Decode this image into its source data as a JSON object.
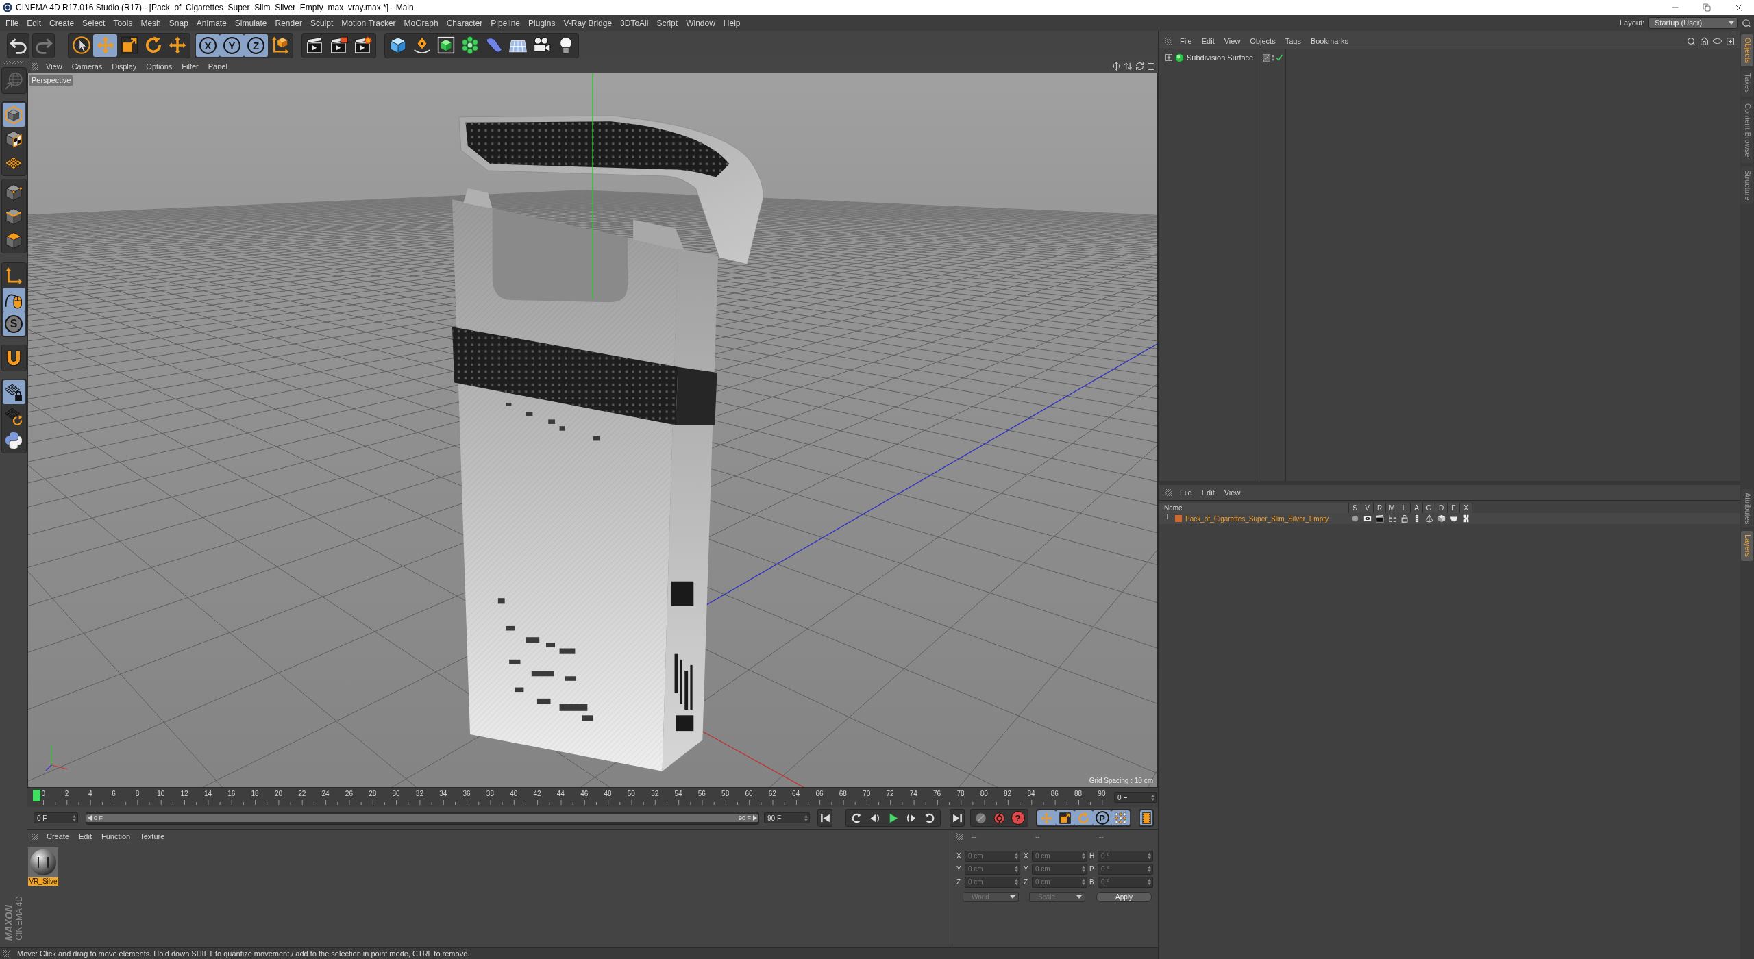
{
  "window": {
    "title": "CINEMA 4D R17.016 Studio (R17) - [Pack_of_Cigarettes_Super_Slim_Silver_Empty_max_vray.max *] - Main"
  },
  "menu_bar": {
    "items": [
      "File",
      "Edit",
      "Create",
      "Select",
      "Tools",
      "Mesh",
      "Snap",
      "Animate",
      "Simulate",
      "Render",
      "Sculpt",
      "Motion Tracker",
      "MoGraph",
      "Character",
      "Pipeline",
      "Plugins",
      "V-Ray Bridge",
      "3DToAll",
      "Script",
      "Window",
      "Help"
    ],
    "layout_label": "Layout:",
    "layout_value": "Startup (User)"
  },
  "toolbar": {
    "groups": [
      [
        {
          "kind": "undo",
          "on": false,
          "disabled": false
        }
      ],
      [
        {
          "kind": "redo",
          "on": false,
          "disabled": true
        }
      ],
      [
        {
          "kind": "select",
          "on": false,
          "disabled": false
        },
        {
          "kind": "move",
          "on": true,
          "disabled": false
        },
        {
          "kind": "scale",
          "on": false,
          "disabled": false
        },
        {
          "kind": "rotate",
          "on": false,
          "disabled": false
        },
        {
          "kind": "recent",
          "on": false,
          "disabled": false
        }
      ],
      [
        {
          "kind": "axis-lock",
          "label": "X",
          "on": true,
          "disabled": false
        },
        {
          "kind": "axis-lock",
          "label": "Y",
          "on": true,
          "disabled": false
        },
        {
          "kind": "axis-lock",
          "label": "Z",
          "on": true,
          "disabled": false
        },
        {
          "kind": "coordinates",
          "on": false,
          "disabled": false
        }
      ],
      [
        {
          "kind": "render-view",
          "on": false,
          "disabled": false
        },
        {
          "kind": "render-picture",
          "on": false,
          "disabled": false
        },
        {
          "kind": "render-settings",
          "on": false,
          "disabled": false
        }
      ],
      [
        {
          "kind": "cube",
          "on": false,
          "disabled": false
        },
        {
          "kind": "pen",
          "on": false,
          "disabled": false
        },
        {
          "kind": "subdivision",
          "on": false,
          "disabled": false
        },
        {
          "kind": "cloner",
          "on": false,
          "disabled": false
        },
        {
          "kind": "deformer",
          "on": false,
          "disabled": false
        },
        {
          "kind": "floor",
          "on": false,
          "disabled": false
        },
        {
          "kind": "camera",
          "on": false,
          "disabled": false
        },
        {
          "kind": "light",
          "on": false,
          "disabled": false
        }
      ]
    ]
  },
  "left_toolbar": {
    "groups": [
      [
        {
          "kind": "make-editable",
          "on": false,
          "disabled": true
        }
      ],
      [
        {
          "kind": "model",
          "on": true,
          "disabled": false
        },
        {
          "kind": "texture",
          "on": false,
          "disabled": false
        },
        {
          "kind": "workplane",
          "on": false,
          "disabled": false
        }
      ],
      [
        {
          "kind": "points",
          "on": false,
          "disabled": false
        },
        {
          "kind": "edges",
          "on": false,
          "disabled": false
        },
        {
          "kind": "polygons",
          "on": false,
          "disabled": false
        }
      ],
      [
        {
          "kind": "axis",
          "on": false,
          "disabled": false
        },
        {
          "kind": "tweak",
          "on": true,
          "disabled": false
        },
        {
          "kind": "solo",
          "label": "S",
          "on": true,
          "disabled": false
        }
      ],
      [
        {
          "kind": "magnet",
          "on": false,
          "disabled": false
        }
      ],
      [
        {
          "kind": "grid-lock",
          "on": true,
          "disabled": false
        },
        {
          "kind": "grid-rotate",
          "on": false,
          "disabled": false
        },
        {
          "kind": "python",
          "on": false,
          "disabled": false
        }
      ]
    ]
  },
  "logo": {
    "brand": "MAXON",
    "product": "CINEMA 4D"
  },
  "viewport": {
    "menu": [
      "View",
      "Cameras",
      "Display",
      "Options",
      "Filter",
      "Panel"
    ],
    "camera": "Perspective",
    "grid_spacing": "Grid Spacing : 10 cm"
  },
  "timeline": {
    "ticks": [
      "0",
      "2",
      "4",
      "6",
      "8",
      "10",
      "12",
      "14",
      "16",
      "18",
      "20",
      "22",
      "24",
      "26",
      "28",
      "30",
      "32",
      "34",
      "36",
      "38",
      "40",
      "42",
      "44",
      "46",
      "48",
      "50",
      "52",
      "54",
      "56",
      "58",
      "60",
      "62",
      "64",
      "66",
      "68",
      "70",
      "72",
      "74",
      "76",
      "78",
      "80",
      "82",
      "84",
      "86",
      "88",
      "90"
    ],
    "level": 0,
    "current_frame": "0 F",
    "start_field": "0 F",
    "range": {
      "start": "0 F",
      "end": "90 F",
      "level": 1
    },
    "end_field": "90 F",
    "controls": [
      [
        {
          "kind": "first-frame",
          "on": false
        }
      ],
      [
        {
          "kind": "prev-key",
          "on": false
        },
        {
          "kind": "prev-frame",
          "on": false
        },
        {
          "kind": "play",
          "on": false
        },
        {
          "kind": "next-frame",
          "on": false
        },
        {
          "kind": "next-key",
          "on": false
        }
      ],
      [
        {
          "kind": "last-frame",
          "on": false
        }
      ],
      [
        {
          "kind": "record",
          "on": false
        },
        {
          "kind": "autokey",
          "on": false
        },
        {
          "kind": "key-selection",
          "label": "?",
          "on": false
        }
      ],
      [
        {
          "kind": "key-position",
          "on": true
        },
        {
          "kind": "key-scale",
          "on": true
        },
        {
          "kind": "key-rotation",
          "on": true
        },
        {
          "kind": "key-parameter",
          "label": "P",
          "on": true
        },
        {
          "kind": "key-pla",
          "on": true
        }
      ],
      [
        {
          "kind": "timeline-window",
          "on": true
        }
      ]
    ]
  },
  "materials": {
    "menu": [
      "Create",
      "Edit",
      "Function",
      "Texture"
    ],
    "items": [
      {
        "name": "VR_Silve",
        "selected": true
      }
    ]
  },
  "coordinates": {
    "headers": [
      "--",
      "--",
      "--"
    ],
    "disabled": true,
    "rows": [
      {
        "position_axis": "X",
        "position": "0 cm",
        "size_axis": "X",
        "size": "0 cm",
        "rotation_axis": "H",
        "rotation": "0 °"
      },
      {
        "position_axis": "Y",
        "position": "0 cm",
        "size_axis": "Y",
        "size": "0 cm",
        "rotation_axis": "P",
        "rotation": "0 °"
      },
      {
        "position_axis": "Z",
        "position": "0 cm",
        "size_axis": "Z",
        "size": "0 cm",
        "rotation_axis": "B",
        "rotation": "0 °"
      }
    ],
    "position_mode": "World",
    "size_mode": "Scale",
    "apply": "Apply"
  },
  "status_bar": "Move: Click and drag to move elements. Hold down SHIFT to quantize movement / add to the selection in point mode, CTRL to remove.",
  "object_manager": {
    "menu": [
      "File",
      "Edit",
      "View",
      "Objects",
      "Tags",
      "Bookmarks"
    ],
    "objects": [
      {
        "name": "Subdivision Surface",
        "expanded": false,
        "enabled": true
      }
    ]
  },
  "layer_manager": {
    "menu": [
      "File",
      "Edit",
      "View"
    ],
    "columns": [
      "Name",
      "S",
      "V",
      "R",
      "M",
      "L",
      "A",
      "G",
      "D",
      "E",
      "X"
    ],
    "layers": [
      {
        "name": "Pack_of_Cigarettes_Super_Slim_Silver_Empty",
        "color": "#d2682e"
      }
    ]
  },
  "side_tabs": {
    "top": [
      {
        "label": "Objects",
        "selected": true
      },
      {
        "label": "Takes",
        "selected": false
      },
      {
        "label": "Content Browser",
        "selected": false
      },
      {
        "label": "Structure",
        "selected": false
      }
    ],
    "bottom": [
      {
        "label": "Attributes",
        "selected": false
      },
      {
        "label": "Layers",
        "selected": true
      }
    ]
  }
}
